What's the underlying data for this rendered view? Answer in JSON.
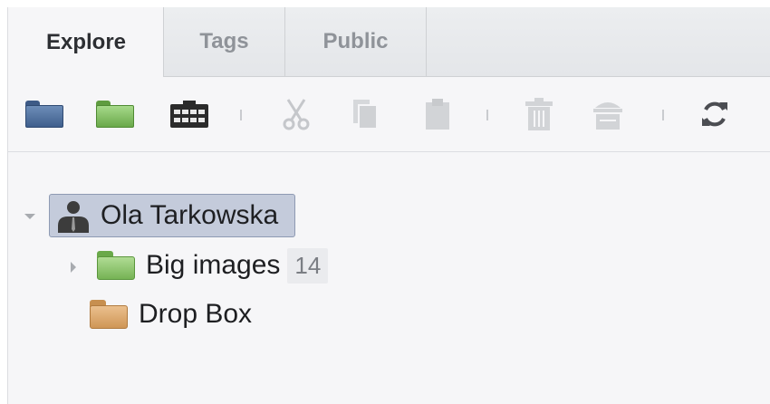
{
  "tabs": [
    {
      "label": "Explore",
      "active": true
    },
    {
      "label": "Tags",
      "active": false
    },
    {
      "label": "Public",
      "active": false
    }
  ],
  "toolbar": {
    "buttons": [
      {
        "icon": "blue-folder-icon",
        "enabled": true
      },
      {
        "icon": "green-folder-icon",
        "enabled": true
      },
      {
        "icon": "film-strip-icon",
        "enabled": true
      },
      {
        "icon": "cut-icon",
        "enabled": false
      },
      {
        "icon": "copy-icon",
        "enabled": false
      },
      {
        "icon": "paste-icon",
        "enabled": false
      },
      {
        "icon": "trash-icon",
        "enabled": false
      },
      {
        "icon": "empty-trash-icon",
        "enabled": false
      },
      {
        "icon": "refresh-icon",
        "enabled": true
      }
    ]
  },
  "tree": {
    "user": {
      "name": "Ola Tarkowska",
      "expanded": true,
      "selected": true
    },
    "children": [
      {
        "name": "Big images",
        "count": "14",
        "expandable": true,
        "icon": "green-folder-icon",
        "color": "#8ec06a"
      },
      {
        "name": "Drop Box",
        "expandable": false,
        "icon": "orange-folder-icon",
        "color": "#dca769"
      }
    ]
  },
  "colors": {
    "selection": "#c4cbdb",
    "blue_folder": "#4a6a96",
    "green_folder": "#7fbf5f",
    "orange_folder": "#dca769"
  }
}
